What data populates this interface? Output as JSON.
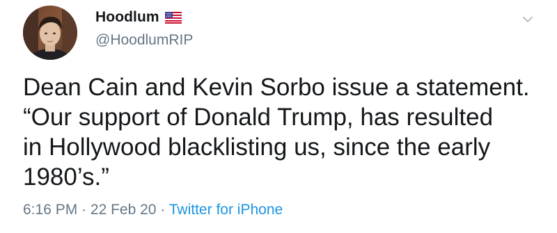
{
  "user": {
    "display_name": "Hoodlum",
    "handle": "@HoodlumRIP",
    "flag_icon": "us-flag-icon",
    "avatar_icon": "profile-avatar"
  },
  "menu_icon": "chevron-down-icon",
  "tweet": {
    "text": "Dean Cain and Kevin Sorbo issue a statement.\n“Our support of Donald Trump, has resulted\nin Hollywood blacklisting us, since the early\n1980’s.”"
  },
  "meta": {
    "time": "6:16 PM",
    "separator_1": " · ",
    "date": "22 Feb 20",
    "separator_2": " · ",
    "source": "Twitter for iPhone"
  },
  "colors": {
    "text": "#14171a",
    "secondary": "#657786",
    "link": "#1b95e0"
  }
}
